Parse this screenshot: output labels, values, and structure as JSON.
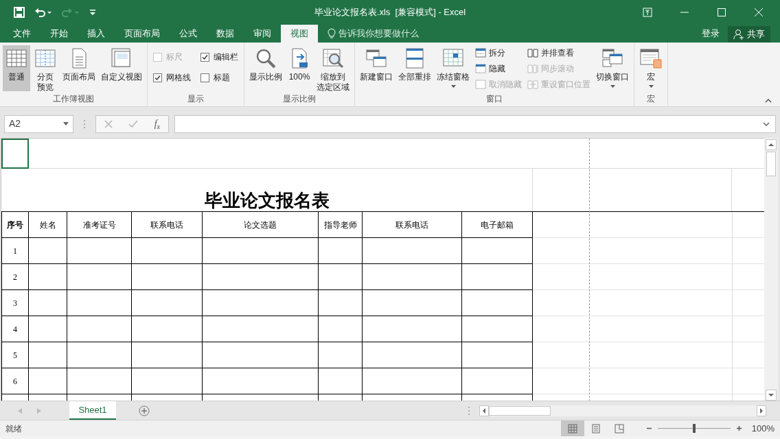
{
  "window": {
    "title": "毕业论文报名表.xls  [兼容模式] - Excel"
  },
  "menu_tabs": [
    {
      "label": "文件",
      "selected": false
    },
    {
      "label": "开始",
      "selected": false
    },
    {
      "label": "插入",
      "selected": false
    },
    {
      "label": "页面布局",
      "selected": false
    },
    {
      "label": "公式",
      "selected": false
    },
    {
      "label": "数据",
      "selected": false
    },
    {
      "label": "审阅",
      "selected": false
    },
    {
      "label": "视图",
      "selected": true
    }
  ],
  "tell_me": {
    "placeholder": "告诉我你想要做什么"
  },
  "account": {
    "sign_in": "登录",
    "share": "共享"
  },
  "ribbon_groups": [
    {
      "label": "工作簿视图",
      "items": [
        {
          "kind": "large",
          "label": "普通",
          "selected": true,
          "menu": false
        },
        {
          "kind": "large",
          "lines": [
            "分页",
            "预览"
          ],
          "selected": false,
          "menu": false
        },
        {
          "kind": "large",
          "label": "页面布局",
          "selected": false,
          "menu": false
        },
        {
          "kind": "large",
          "label": "自定义视图",
          "selected": false,
          "menu": false
        }
      ]
    },
    {
      "label": "显示",
      "items": [
        {
          "kind": "checks",
          "items": [
            {
              "label": "标尺",
              "checked": false,
              "disabled": true
            },
            {
              "label": "编辑栏",
              "checked": true,
              "disabled": false
            },
            {
              "label": "网格线",
              "checked": true,
              "disabled": false
            },
            {
              "label": "标题",
              "checked": false,
              "disabled": false
            }
          ]
        }
      ]
    },
    {
      "label": "显示比例",
      "items": [
        {
          "kind": "large",
          "label": "显示比例",
          "selected": false,
          "menu": false
        },
        {
          "kind": "large",
          "label": "100%",
          "selected": false,
          "menu": false
        },
        {
          "kind": "large",
          "lines": [
            "缩放到",
            "选定区域"
          ],
          "selected": false,
          "menu": false
        }
      ]
    },
    {
      "label": "窗口",
      "items": [
        {
          "kind": "large",
          "label": "新建窗口",
          "selected": false,
          "menu": false
        },
        {
          "kind": "large",
          "label": "全部重排",
          "selected": false,
          "menu": false
        },
        {
          "kind": "large",
          "label": "冻结窗格",
          "selected": false,
          "menu": true
        },
        {
          "kind": "stack",
          "items": [
            {
              "label": "拆分",
              "disabled": false
            },
            {
              "label": "隐藏",
              "disabled": false
            },
            {
              "label": "取消隐藏",
              "disabled": true
            }
          ]
        },
        {
          "kind": "stack",
          "items": [
            {
              "label": "并排查看",
              "disabled": false
            },
            {
              "label": "同步滚动",
              "disabled": true
            },
            {
              "label": "重设窗口位置",
              "disabled": true
            }
          ]
        },
        {
          "kind": "large",
          "label": "切换窗口",
          "selected": false,
          "menu": true
        }
      ]
    },
    {
      "label": "宏",
      "items": [
        {
          "kind": "large",
          "label": "宏",
          "selected": false,
          "menu": true
        }
      ]
    }
  ],
  "formula_bar": {
    "name_box": "A2",
    "insert_function": "f$_{x}$"
  },
  "sheet": {
    "title": "毕业论文报名表",
    "columns": [
      "序号",
      "姓名",
      "准考证号",
      "联系电话",
      "论文选题",
      "指导老师",
      "联系电话",
      "电子邮箱"
    ],
    "rows": [
      {
        "number": "1"
      },
      {
        "number": "2"
      },
      {
        "number": "3"
      },
      {
        "number": "4"
      },
      {
        "number": "5"
      },
      {
        "number": "6"
      }
    ]
  },
  "sheet_tabs": [
    {
      "label": "Sheet1",
      "selected": true
    }
  ],
  "status_bar": {
    "status": "就绪",
    "view_modes": [
      {
        "selected": true
      },
      {
        "selected": false
      },
      {
        "selected": false
      }
    ],
    "zoom": {
      "level": 0.5,
      "reading": "100%"
    }
  }
}
